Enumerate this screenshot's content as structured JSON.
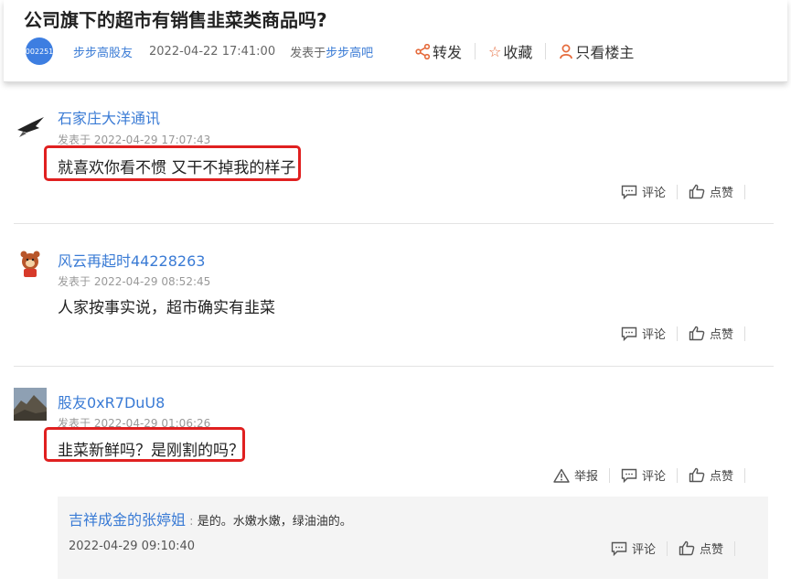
{
  "post": {
    "title": "公司旗下的超市有销售韭菜类商品吗?",
    "avatar_text": "002251",
    "author": "步步高股友",
    "time": "2022-04-22 17:41:00",
    "posted_in_label": "发表于",
    "forum": "步步高吧",
    "actions": {
      "share": "转发",
      "favorite": "收藏",
      "only_op": "只看楼主"
    }
  },
  "comments": [
    {
      "name": "石家庄大洋通讯",
      "time": "发表于 2022-04-29 17:07:43",
      "body": "就喜欢你看不惯 又干不掉我的样子",
      "avatar_icon": "bird-avatar-icon",
      "actions": {
        "comment": "评论",
        "like": "点赞"
      }
    },
    {
      "name": "风云再起时44228263",
      "time": "发表于 2022-04-29 08:52:45",
      "body": "人家按事实说，超市确实有韭菜",
      "avatar_icon": "cartoon-avatar-icon",
      "actions": {
        "comment": "评论",
        "like": "点赞"
      }
    },
    {
      "name": "股友0xR7DuU8",
      "time": "发表于 2022-04-29 01:06:26",
      "body": "韭菜新鲜吗？是刚割的吗？",
      "avatar_icon": "landscape-avatar-icon",
      "actions": {
        "report": "举报",
        "comment": "评论",
        "like": "点赞"
      }
    }
  ],
  "reply": {
    "name": "吉祥成金的张婷姐",
    "separator": ":",
    "text": "是的。水嫩水嫩，绿油油的。",
    "time": "2022-04-29 09:10:40",
    "actions": {
      "comment": "评论",
      "like": "点赞"
    }
  },
  "colors": {
    "link": "#3a7bd5",
    "highlight": "#e02020",
    "share_icon": "#e56b3c"
  }
}
